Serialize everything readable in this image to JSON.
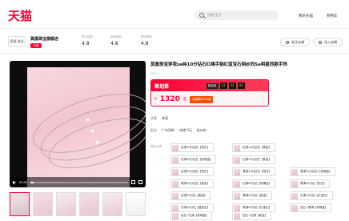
{
  "header": {
    "logo": "天猫",
    "search_placeholder": "搜索宝贝",
    "links": [
      "我的天猫",
      "购物车"
    ]
  },
  "shop": {
    "logo_text": "莫凰·珠宝",
    "name": "莫凰珠宝旗舰店",
    "tag": "天猫",
    "scores": [
      {
        "label": "宝贝描述",
        "value": "4.8"
      },
      {
        "label": "卖家服务",
        "value": "4.8"
      },
      {
        "label": "物流服务",
        "value": "4.8"
      }
    ],
    "buttons": [
      "关注店铺",
      "进入店铺"
    ]
  },
  "gallery": {
    "time": "00:00",
    "thumb_count": 6,
    "selected_thumb": 0
  },
  "product": {
    "title": "莫凰珠宝穿我sa纯10分钻石红绳手链红蓝宝石网纱同Sa明星同款手饰",
    "sub": "月销 1",
    "promo_label": "聚划算",
    "countdown_label": "距结束",
    "countdown": [
      "12",
      "22",
      "43"
    ],
    "price_currency": "¥",
    "price": "1320",
    "price_unit": "起",
    "coupon": "店铺满1200减",
    "service_label": "优惠",
    "service_value": "承诺",
    "ship_label": "配送",
    "ship_from": "广东深圳",
    "ship_to": "杭州市",
    "ship_fee": "快递 0元",
    "options_label": "颜色分类",
    "options": [
      "红绳10分钻石【铂白】",
      "红绳10分钻石【黄金】",
      "红绳10分钻石【玫瑰金】",
      "红绳10分钻石【紫金】",
      "红绳20分钻石【铂白】",
      "黑绳10分钻石【铂白】",
      "黑绳10分钻石【玫瑰金】",
      "黑绳10分钻石【紫金】",
      "红绳20分钻【玫瑰金】",
      "黑绳20分钻【铂白】",
      "红绳20分钻【紫金】",
      "黑绳20分钻【紫金】",
      "红绳10分钻【红宝石】",
      "红绳10分钻【蓝宝石】",
      "黑绳20分钻【红宝石】",
      "钻石+黑绳【玫瑰金】",
      "钻石+红绳【玫瑰金】",
      "钻石+红绳【紫金】"
    ]
  }
}
